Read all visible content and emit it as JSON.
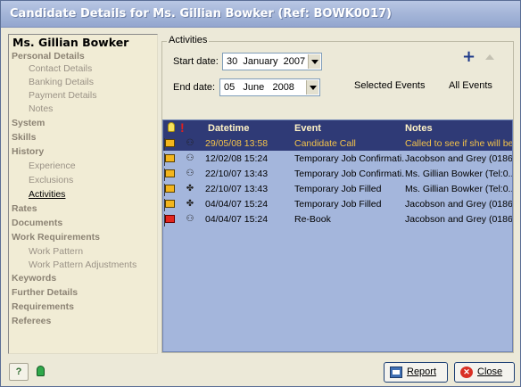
{
  "window": {
    "title": "Candidate Details for Ms. Gillian Bowker (Ref: BOWK0017)"
  },
  "nav": {
    "candidate_name": "Ms. Gillian Bowker",
    "items": [
      {
        "label": "Personal Details",
        "level": "section"
      },
      {
        "label": "Contact Details",
        "level": "sub"
      },
      {
        "label": "Banking Details",
        "level": "sub"
      },
      {
        "label": "Payment Details",
        "level": "sub"
      },
      {
        "label": "Notes",
        "level": "sub"
      },
      {
        "label": "System",
        "level": "section"
      },
      {
        "label": "Skills",
        "level": "section"
      },
      {
        "label": "History",
        "level": "section"
      },
      {
        "label": "Experience",
        "level": "sub"
      },
      {
        "label": "Exclusions",
        "level": "sub"
      },
      {
        "label": "Activities",
        "level": "sub",
        "active": true
      },
      {
        "label": "Rates",
        "level": "section"
      },
      {
        "label": "Documents",
        "level": "section"
      },
      {
        "label": "Work Requirements",
        "level": "section"
      },
      {
        "label": "Work Pattern",
        "level": "sub"
      },
      {
        "label": "Work Pattern Adjustments",
        "level": "sub"
      },
      {
        "label": "Keywords",
        "level": "section"
      },
      {
        "label": "Further Details",
        "level": "section"
      },
      {
        "label": "Requirements",
        "level": "section"
      },
      {
        "label": "Referees",
        "level": "section"
      }
    ]
  },
  "activities": {
    "group_label": "Activities",
    "start_label": "Start date:",
    "start_day": "30",
    "start_month": "January",
    "start_year": "2007",
    "end_label": "End date:",
    "end_day": "05",
    "end_month": "June",
    "end_year": "2008",
    "add_icon": "plus-icon",
    "sort_icon": "triangle-up-icon",
    "filter_selected": "Selected Events",
    "filter_all": "All Events",
    "columns": {
      "datetime": "Datetime",
      "event": "Event",
      "notes": "Notes"
    },
    "rows": [
      {
        "flag": "yellow",
        "datetime": "29/05/08 13:58",
        "event": "Candidate Call",
        "notes": "Called to see if she will be...",
        "selected": true
      },
      {
        "flag": "yellow",
        "datetime": "12/02/08 15:24",
        "event": "Temporary Job Confirmati..",
        "notes": "Jacobson and Grey (0186...",
        "selected": false
      },
      {
        "flag": "yellow",
        "datetime": "22/10/07 13:43",
        "event": "Temporary Job Confirmati..",
        "notes": "Ms. Gillian Bowker (Tel:0...",
        "selected": false
      },
      {
        "flag": "yellow",
        "datetime": "22/10/07 13:43",
        "event": "Temporary Job Filled",
        "notes": "Ms. Gillian Bowker (Tel:0...",
        "selected": false
      },
      {
        "flag": "yellow",
        "datetime": "04/04/07 15:24",
        "event": "Temporary Job Filled",
        "notes": "Jacobson and Grey (0186...",
        "selected": false
      },
      {
        "flag": "red",
        "datetime": "04/04/07 15:24",
        "event": "Re-Book",
        "notes": "Jacobson and Grey (0186...",
        "selected": false
      }
    ]
  },
  "footer": {
    "report_label": "Report",
    "close_label": "Close"
  },
  "colors": {
    "nav_bg": "#f1ecd5",
    "grid_bg": "#a4b6dc",
    "header_bg": "#2f3a76",
    "selected_text": "#f3c24a",
    "title_bar": "#a4b5d8"
  }
}
